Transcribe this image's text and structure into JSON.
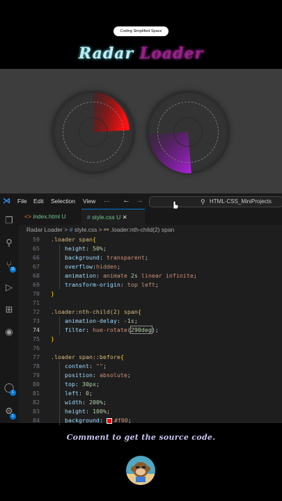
{
  "banner": {
    "badge": "Coding Simplified Space",
    "title_word1": "Radar",
    "title_word2": "Loader"
  },
  "colors": {
    "radar1_sweep": "#e01010",
    "radar2_sweep": "#a020c8",
    "preview_bg": "#3d3d3d"
  },
  "menubar": {
    "logo_icon": "vscode-icon",
    "items": [
      "File",
      "Edit",
      "Selection",
      "View",
      "···"
    ],
    "back_icon": "arrow-left-icon",
    "forward_icon": "arrow-right-icon",
    "search": "HTML-CSS_MiniProjects"
  },
  "activity_badges": {
    "source_control": "11",
    "accounts": "1",
    "manage": "1"
  },
  "tabs": [
    {
      "icon": "<>",
      "label": "index.html",
      "status": "U"
    },
    {
      "icon": "#",
      "label": "style.css",
      "status": "U",
      "close": "✕"
    }
  ],
  "breadcrumb": {
    "folder": "Radar Loader",
    "sep1": ">",
    "file_icon": "#",
    "file": "style.css",
    "sep2": ">",
    "symbol": ".loader:nth-child(2) span"
  },
  "code": [
    {
      "n": "59",
      "t": [
        [
          ".loader span",
          "sel"
        ],
        [
          "{",
          "brace"
        ]
      ]
    },
    {
      "n": "65",
      "t": [
        [
          "    height",
          "prop"
        ],
        [
          ": ",
          "pun"
        ],
        [
          "50%",
          "num"
        ],
        [
          ";",
          "pun"
        ]
      ]
    },
    {
      "n": "66",
      "t": [
        [
          "    background",
          "prop"
        ],
        [
          ": ",
          "pun"
        ],
        [
          "transparent",
          "val"
        ],
        [
          ";",
          "pun"
        ]
      ]
    },
    {
      "n": "67",
      "t": [
        [
          "    overflow",
          "prop"
        ],
        [
          ":",
          "pun"
        ],
        [
          "hidden",
          "val"
        ],
        [
          ";",
          "pun"
        ]
      ]
    },
    {
      "n": "68",
      "t": [
        [
          "    animation",
          "prop"
        ],
        [
          ": ",
          "pun"
        ],
        [
          "animate ",
          "val"
        ],
        [
          "2s",
          "num"
        ],
        [
          " linear infinite",
          "val"
        ],
        [
          ";",
          "pun"
        ]
      ]
    },
    {
      "n": "69",
      "t": [
        [
          "    transform-origin",
          "prop"
        ],
        [
          ": ",
          "pun"
        ],
        [
          "top left",
          "val"
        ],
        [
          ";",
          "pun"
        ]
      ]
    },
    {
      "n": "70",
      "t": [
        [
          "}",
          "brace"
        ]
      ]
    },
    {
      "n": "71",
      "t": []
    },
    {
      "n": "72",
      "t": [
        [
          ".loader:nth-child(2) span",
          "sel"
        ],
        [
          "{",
          "brace"
        ]
      ]
    },
    {
      "n": "73",
      "t": [
        [
          "    animation-delay",
          "prop"
        ],
        [
          ": ",
          "pun"
        ],
        [
          "-1s",
          "num"
        ],
        [
          ";",
          "pun"
        ]
      ]
    },
    {
      "n": "74",
      "t": [
        [
          "    filter",
          "prop"
        ],
        [
          ": ",
          "pun"
        ],
        [
          "hue-rotate",
          "val"
        ],
        [
          "(",
          "pun"
        ],
        [
          "290deg",
          "num"
        ],
        [
          ")",
          "pun"
        ],
        [
          ";",
          "pun"
        ]
      ],
      "current": true
    },
    {
      "n": "75",
      "t": [
        [
          "}",
          "brace"
        ]
      ]
    },
    {
      "n": "76",
      "t": []
    },
    {
      "n": "77",
      "t": [
        [
          ".loader span::before",
          "sel"
        ],
        [
          "{",
          "brace"
        ]
      ]
    },
    {
      "n": "78",
      "t": [
        [
          "    content",
          "prop"
        ],
        [
          ": ",
          "pun"
        ],
        [
          "\"\"",
          "val"
        ],
        [
          ";",
          "pun"
        ]
      ]
    },
    {
      "n": "79",
      "t": [
        [
          "    position",
          "prop"
        ],
        [
          ": ",
          "pun"
        ],
        [
          "absolute",
          "val"
        ],
        [
          ";",
          "pun"
        ]
      ]
    },
    {
      "n": "80",
      "t": [
        [
          "    top",
          "prop"
        ],
        [
          ": ",
          "pun"
        ],
        [
          "30px",
          "num"
        ],
        [
          ";",
          "pun"
        ]
      ]
    },
    {
      "n": "81",
      "t": [
        [
          "    left",
          "prop"
        ],
        [
          ": ",
          "pun"
        ],
        [
          "0",
          "num"
        ],
        [
          ";",
          "pun"
        ]
      ]
    },
    {
      "n": "82",
      "t": [
        [
          "    width",
          "prop"
        ],
        [
          ": ",
          "pun"
        ],
        [
          "200%",
          "num"
        ],
        [
          ";",
          "pun"
        ]
      ]
    },
    {
      "n": "83",
      "t": [
        [
          "    height",
          "prop"
        ],
        [
          ": ",
          "pun"
        ],
        [
          "100%",
          "num"
        ],
        [
          ";",
          "pun"
        ]
      ]
    },
    {
      "n": "84",
      "t": [
        [
          "    background",
          "prop"
        ],
        [
          ": ",
          "pun"
        ],
        [
          "#f00",
          "val"
        ],
        [
          ";",
          "pun"
        ]
      ],
      "swatch": true
    }
  ],
  "footer": {
    "comment": "Comment to get the source code."
  }
}
